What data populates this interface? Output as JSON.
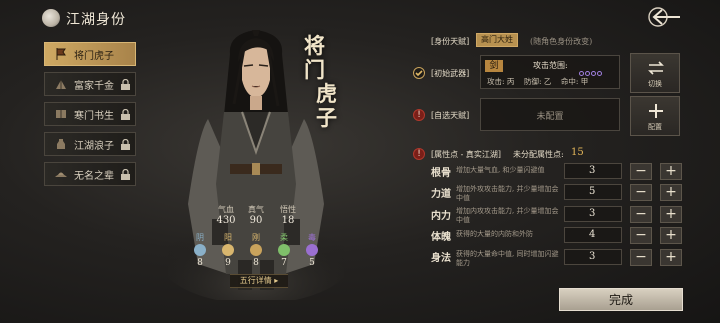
{
  "header": {
    "title": "江湖身份",
    "icon": "yin-yang-icon",
    "back_icon": "back-arrow-icon"
  },
  "sidebar": {
    "items": [
      {
        "label": "将门虎子",
        "icon": "banner-icon",
        "active": true,
        "locked": false
      },
      {
        "label": "富家千金",
        "icon": "fan-icon",
        "active": false,
        "locked": true
      },
      {
        "label": "寒门书生",
        "icon": "book-icon",
        "active": false,
        "locked": true
      },
      {
        "label": "江湖浪子",
        "icon": "wine-jug-icon",
        "active": false,
        "locked": true
      },
      {
        "label": "无名之辈",
        "icon": "straw-hat-icon",
        "active": false,
        "locked": true
      }
    ]
  },
  "character": {
    "name_chars": [
      "将",
      "门",
      "虎",
      "子"
    ],
    "stats": [
      {
        "label": "气血",
        "value": "430"
      },
      {
        "label": "真气",
        "value": "90"
      },
      {
        "label": "悟性",
        "value": "18"
      }
    ],
    "elements": [
      {
        "label": "阴",
        "value": "8",
        "color": "#8ab0c8"
      },
      {
        "label": "阳",
        "value": "9",
        "color": "#d8b66e"
      },
      {
        "label": "刚",
        "value": "8",
        "color": "#d8b66e"
      },
      {
        "label": "柔",
        "value": "7",
        "color": "#7fbf6a"
      },
      {
        "label": "毒",
        "value": "5",
        "color": "#9a6fd0"
      }
    ],
    "detail_button": "五行详情"
  },
  "identity": {
    "label": "[身份天赋]",
    "tag": "高门大姓",
    "hint": "(随角色身份改变)"
  },
  "weapon": {
    "label": "[初始武器]",
    "name": "剑",
    "range_label": "攻击范围:",
    "range_dots": 4,
    "grades": "攻击: 丙    防御: 乙    命中: 甲",
    "switch_label": "切换",
    "switch_icon": "swap-arrows-icon"
  },
  "talent": {
    "label": "[自选天赋]",
    "placeholder": "未配置",
    "config_label": "配置",
    "config_icon": "plus-icon"
  },
  "attributes": {
    "header": "[属性点 - 真实江湖]",
    "remaining_label": "未分配属性点:",
    "remaining_value": "15",
    "rows": [
      {
        "name": "根骨",
        "desc": "增加大量气血, 和少量闪避值",
        "value": "3"
      },
      {
        "name": "力道",
        "desc": "增加外攻攻击能力, 并少量增加会中值",
        "value": "5"
      },
      {
        "name": "内力",
        "desc": "增加内攻攻击能力, 并少量增加会中值",
        "value": "3"
      },
      {
        "name": "体魄",
        "desc": "获得的大量的内防和外防",
        "value": "4"
      },
      {
        "name": "身法",
        "desc": "获得的大量命中值, 同时增加闪避能力",
        "value": "3"
      }
    ],
    "minus": "−",
    "plus": "+"
  },
  "footer": {
    "done_label": "完成"
  }
}
